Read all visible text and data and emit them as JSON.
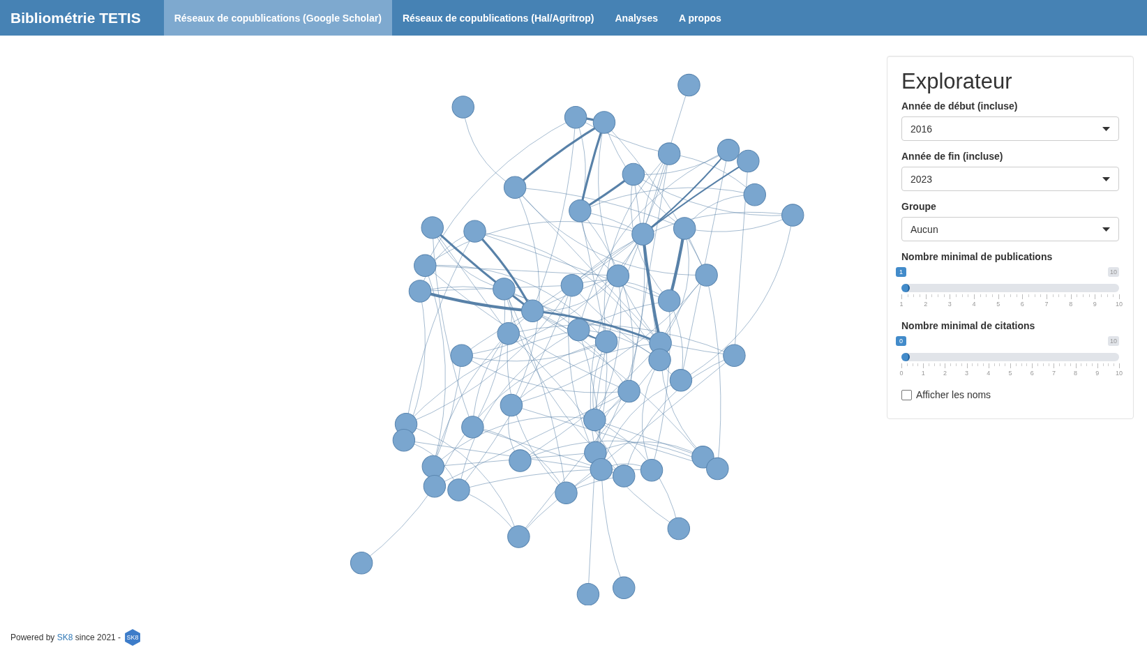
{
  "navbar": {
    "brand": "Bibliométrie TETIS",
    "tabs": [
      {
        "label": "Réseaux de copublications (Google Scholar)",
        "selected": true
      },
      {
        "label": "Réseaux de copublications (Hal/Agritrop)",
        "selected": false
      },
      {
        "label": "Analyses",
        "selected": false
      },
      {
        "label": "A propos",
        "selected": false
      }
    ]
  },
  "sidebar": {
    "title": "Explorateur",
    "selects": [
      {
        "label": "Année de début (incluse)",
        "value": "2016"
      },
      {
        "label": "Année de fin (incluse)",
        "value": "2023"
      },
      {
        "label": "Groupe",
        "value": "Aucun"
      }
    ],
    "sliders": [
      {
        "label": "Nombre minimal de publications",
        "value": "1",
        "max_label": "10",
        "level": 0,
        "ticks": [
          "1",
          "2",
          "3",
          "4",
          "5",
          "6",
          "7",
          "8",
          "9",
          "10"
        ]
      },
      {
        "label": "Nombre minimal de citations",
        "value": "0",
        "max_label": "10",
        "level": 0,
        "ticks": [
          "0",
          "1",
          "2",
          "3",
          "4",
          "5",
          "6",
          "7",
          "8",
          "9",
          "10"
        ]
      }
    ],
    "checkbox": {
      "label": "Afficher les noms",
      "checked": false
    }
  },
  "footer": {
    "before": "Powered by",
    "link": "SK8",
    "after": "since 2021 -",
    "logo": "SK8"
  }
}
